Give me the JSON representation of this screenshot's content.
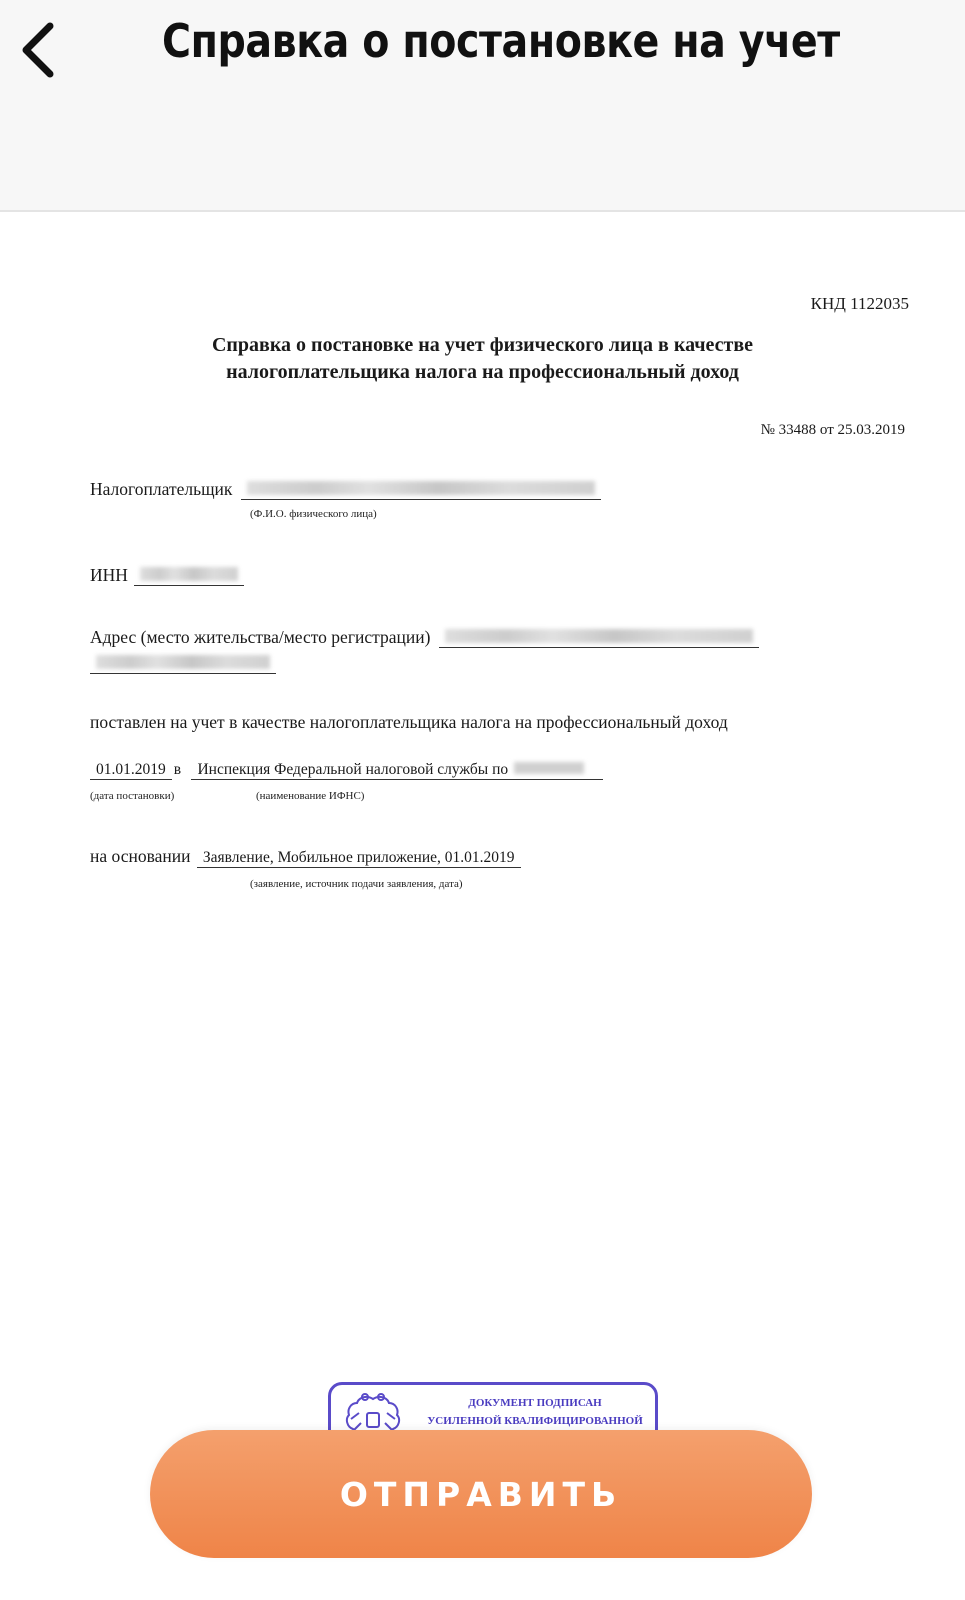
{
  "header": {
    "title": "Справка о постановке на учет",
    "back_icon": "chevron-left-icon"
  },
  "document": {
    "knd": "КНД 1122035",
    "title_line1": "Справка о постановке на учет физического лица в качестве",
    "title_line2": "налогоплательщика налога на профессиональный доход",
    "number": "№ 33488 от 25.03.2019",
    "taxpayer_label": "Налогоплательщик",
    "taxpayer_caption": "(Ф.И.О. физического лица)",
    "inn_label": "ИНН",
    "address_label": "Адрес (место жительства/место регистрации)",
    "registered_text": "поставлен на учет в качестве налогоплательщика налога на профессиональный доход",
    "reg_date": "01.01.2019",
    "reg_in": "в",
    "inspection": "Инспекция Федеральной налоговой службы по",
    "date_caption": "(дата постановки)",
    "ifns_caption": "(наименование ИФНС)",
    "basis_label": "на основании",
    "basis_value": "Заявление, Мобильное приложение, 01.01.2019",
    "basis_caption": "(заявление, источник подачи заявления, дата)"
  },
  "stamp": {
    "line1": "ДОКУМЕНТ ПОДПИСАН",
    "line2": "УСИЛЕННОЙ КВАЛИФИЦИРОВАННОЙ",
    "emblem_icon": "coat-of-arms-icon",
    "color": "#5a4bc9"
  },
  "actions": {
    "send_label": "ОТПРАВИТЬ",
    "send_color": "#ef8448"
  }
}
